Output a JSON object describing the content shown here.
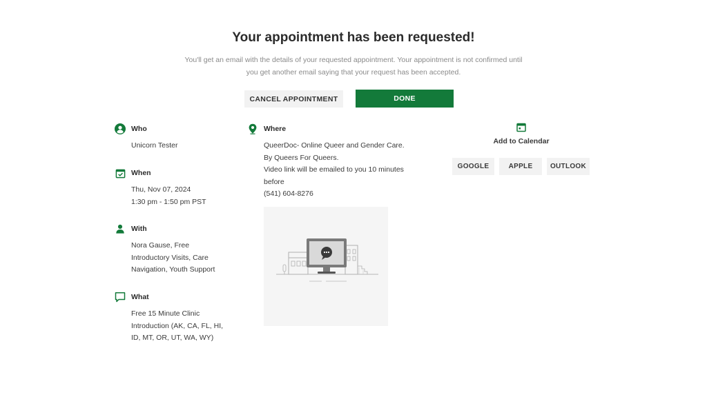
{
  "header": {
    "title": "Your appointment has been requested!",
    "subtitle_line1": "You'll get an email with the details of your requested appointment. Your appointment is not confirmed until",
    "subtitle_line2": "you get another email saying that your request has been accepted."
  },
  "actions": {
    "cancel_label": "CANCEL APPOINTMENT",
    "done_label": "DONE"
  },
  "details": {
    "who": {
      "label": "Who",
      "lines": [
        "Unicorn Tester"
      ]
    },
    "when": {
      "label": "When",
      "lines": [
        "Thu, Nov 07, 2024",
        "1:30 pm - 1:50 pm PST"
      ]
    },
    "with": {
      "label": "With",
      "lines": [
        "Nora Gause, Free",
        "Introductory Visits, Care",
        "Navigation, Youth Support"
      ]
    },
    "what": {
      "label": "What",
      "lines": [
        "Free 15 Minute Clinic",
        "Introduction (AK, CA, FL, HI,",
        "ID, MT, OR, UT, WA, WY)"
      ]
    },
    "where": {
      "label": "Where",
      "lines": [
        "QueerDoc- Online Queer and Gender Care.",
        "By Queers For Queers.",
        "Video link will be emailed to you 10 minutes",
        "before",
        "(541) 604-8276"
      ]
    }
  },
  "calendar": {
    "label": "Add to Calendar",
    "buttons": [
      "GOOGLE",
      "APPLE",
      "OUTLOOK"
    ]
  },
  "icons": {
    "who": "person-circle-icon",
    "when": "calendar-check-icon",
    "with": "person-icon",
    "what": "chat-bubble-icon",
    "where": "location-pin-icon",
    "calendar": "calendar-icon"
  },
  "colors": {
    "accent": "#137a3a",
    "button_gray": "#f2f2f2",
    "muted_text": "#8a8a8a"
  }
}
